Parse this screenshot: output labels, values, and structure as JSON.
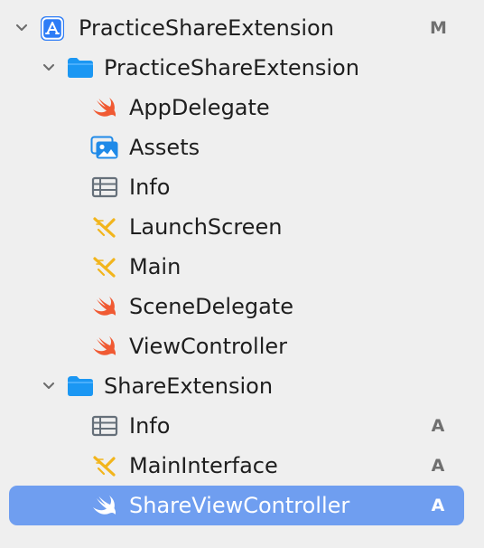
{
  "navigator": {
    "items": [
      {
        "label": "PracticeShareExtension",
        "kind": "project",
        "icon": "xcode-project-icon",
        "expanded": true,
        "status": "M",
        "selected": false
      },
      {
        "label": "PracticeShareExtension",
        "kind": "folder",
        "icon": "folder-icon",
        "expanded": true,
        "status": "",
        "selected": false
      },
      {
        "label": "AppDelegate",
        "kind": "swift-file",
        "icon": "swift-icon",
        "status": "",
        "selected": false
      },
      {
        "label": "Assets",
        "kind": "asset-catalog",
        "icon": "assets-icon",
        "status": "",
        "selected": false
      },
      {
        "label": "Info",
        "kind": "property-list",
        "icon": "plist-icon",
        "status": "",
        "selected": false
      },
      {
        "label": "LaunchScreen",
        "kind": "storyboard",
        "icon": "storyboard-icon",
        "status": "",
        "selected": false
      },
      {
        "label": "Main",
        "kind": "storyboard",
        "icon": "storyboard-icon",
        "status": "",
        "selected": false
      },
      {
        "label": "SceneDelegate",
        "kind": "swift-file",
        "icon": "swift-icon",
        "status": "",
        "selected": false
      },
      {
        "label": "ViewController",
        "kind": "swift-file",
        "icon": "swift-icon",
        "status": "",
        "selected": false
      },
      {
        "label": "ShareExtension",
        "kind": "folder",
        "icon": "folder-icon",
        "expanded": true,
        "status": "",
        "selected": false
      },
      {
        "label": "Info",
        "kind": "property-list",
        "icon": "plist-icon",
        "status": "A",
        "selected": false
      },
      {
        "label": "MainInterface",
        "kind": "storyboard",
        "icon": "storyboard-icon",
        "status": "A",
        "selected": false
      },
      {
        "label": "ShareViewController",
        "kind": "swift-file",
        "icon": "swift-icon",
        "status": "A",
        "selected": true
      }
    ]
  },
  "colors": {
    "background": "#efefef",
    "selection": "#6f9ef0",
    "swift": "#f05a33",
    "folder": "#1b97f3",
    "storyboard": "#f2b51c",
    "project": "#2d7cf6",
    "status": "#6f6f6f"
  }
}
